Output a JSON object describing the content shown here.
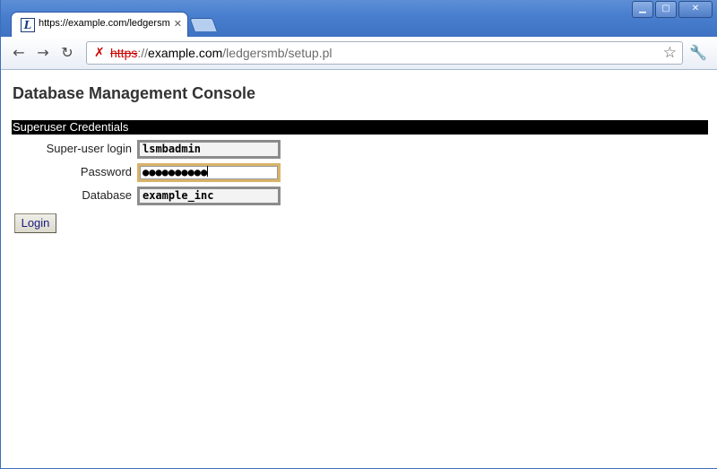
{
  "browser": {
    "tab_title": "https://example.com/ledgersm",
    "tab_favicon": "L",
    "url_scheme": "https",
    "url_sep": "://",
    "url_host": "example.com",
    "url_path": "/ledgersmb/setup.pl"
  },
  "page": {
    "title": "Database Management Console",
    "section": "Superuser Credentials",
    "fields": [
      {
        "label": "Super-user login",
        "value": "lsmbadmin"
      },
      {
        "label": "Password",
        "value": "●●●●●●●●●●"
      },
      {
        "label": "Database",
        "value": "example_inc"
      }
    ],
    "login_label": "Login"
  },
  "colors": {
    "titlebar": "#4a7fcf",
    "section_bar": "#000000",
    "focus_border": "#d8b36a"
  }
}
